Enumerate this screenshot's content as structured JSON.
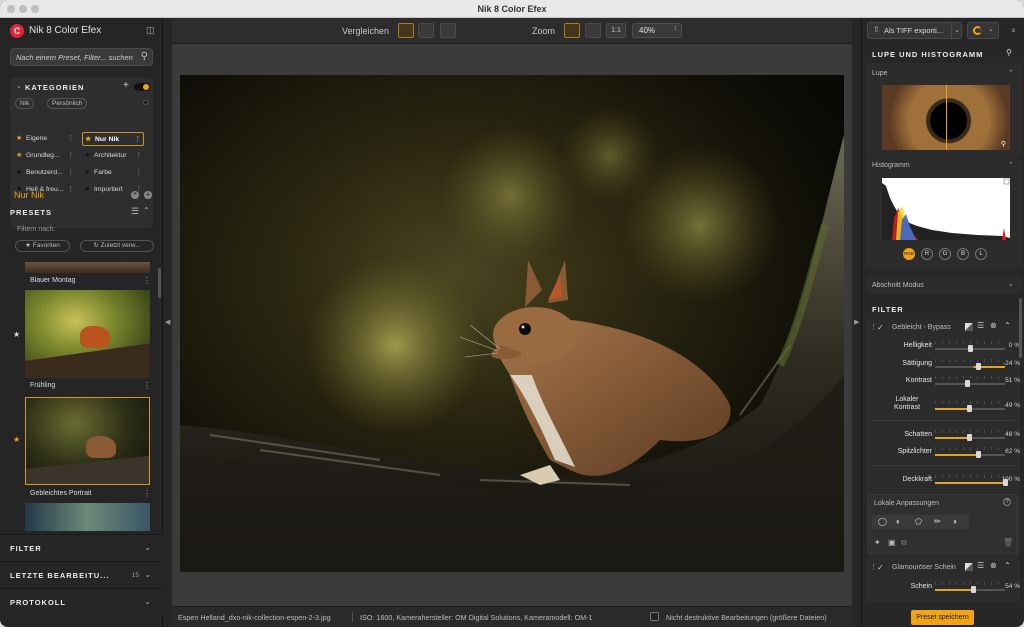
{
  "window": {
    "title": "Nik 8 Color Efex"
  },
  "left": {
    "app_title": "Nik 8 Color Efex",
    "search_placeholder": "Nach einem Preset, Filter... suchen",
    "categories": {
      "title": "KATEGORIEN",
      "pills": [
        "Nik",
        "Persönlich"
      ],
      "items": [
        {
          "label": "Eigene",
          "starred": true
        },
        {
          "label": "Nur Nik",
          "starred": true,
          "selected": true
        },
        {
          "label": "Grundleg...",
          "starred": true
        },
        {
          "label": "Architektur",
          "starred": false
        },
        {
          "label": "Benutzerd...",
          "starred": false
        },
        {
          "label": "Farbe",
          "starred": false
        },
        {
          "label": "Hell & freu...",
          "starred": false
        },
        {
          "label": "Importiert",
          "starred": false
        }
      ]
    },
    "current_category": "Nur Nik",
    "presets": {
      "title": "PRESETS",
      "filter_label": "Filtern nach:",
      "filter_pills": [
        "Favoriten",
        "Zuletzt verw..."
      ],
      "items": [
        {
          "label": "Blauer Montag"
        },
        {
          "label": "Frühling"
        },
        {
          "label": "Gebleichtes Portrait"
        }
      ]
    },
    "sections": [
      {
        "title": "FILTER",
        "badge": ""
      },
      {
        "title": "LETZTE BEARBEITU...",
        "badge": "15"
      },
      {
        "title": "PROTOKOLL",
        "badge": ""
      }
    ]
  },
  "toolbar": {
    "compare_label": "Vergleichen",
    "zoom_label": "Zoom",
    "zoom_one": "1:1",
    "zoom_value": "40%"
  },
  "status": {
    "file": "Espen Helland_dxo-nik-collection-espen-2-3.jpg",
    "meta": "ISO: 1600, Kamerahersteller: OM Digital Solutions, Kameramodell: OM-1",
    "nondestructive": "Nicht destruktive Bearbeitungen (größere Dateien)"
  },
  "right": {
    "export_label": "Als TIFF exporti...",
    "panel_title": "LUPE UND HISTOGRAMM",
    "loupe_label": "Lupe",
    "histogram_label": "Histogramm",
    "channels": [
      "RGB",
      "R",
      "G",
      "B",
      "L"
    ],
    "section_mode": "Abschnitt Modus",
    "filter_title": "FILTER",
    "filter1": {
      "name": "Gebleicht - Bypass",
      "sliders": [
        {
          "label": "Helligkeit",
          "value": "0 %",
          "pos": 0.5,
          "fill": 0
        },
        {
          "label": "Sättigung",
          "value": "-24 %",
          "pos": 0.62,
          "fill": 1
        },
        {
          "label": "Kontrast",
          "value": "51 %",
          "pos": 0.45,
          "fill": 0
        },
        {
          "label": "Lokaler Kontrast",
          "value": "49 %",
          "pos": 0.49,
          "fill": 0.49
        },
        {
          "label": "Schatten",
          "value": "48 %",
          "pos": 0.48,
          "fill": 0.48
        },
        {
          "label": "Spitzlichter",
          "value": "62 %",
          "pos": 0.62,
          "fill": 0.62
        },
        {
          "label": "Deckkraft",
          "value": "100 %",
          "pos": 1,
          "fill": 1
        }
      ],
      "local_adjust": "Lokale Anpassungen"
    },
    "filter2": {
      "name": "Glamouröser Schein",
      "sliders": [
        {
          "label": "Schein",
          "value": "54 %",
          "pos": 0.54,
          "fill": 0.54
        }
      ]
    },
    "save_preset": "Preset speichern"
  },
  "colors": {
    "accent": "#f0a315",
    "panel": "#272727",
    "logo": "#e5223a"
  }
}
